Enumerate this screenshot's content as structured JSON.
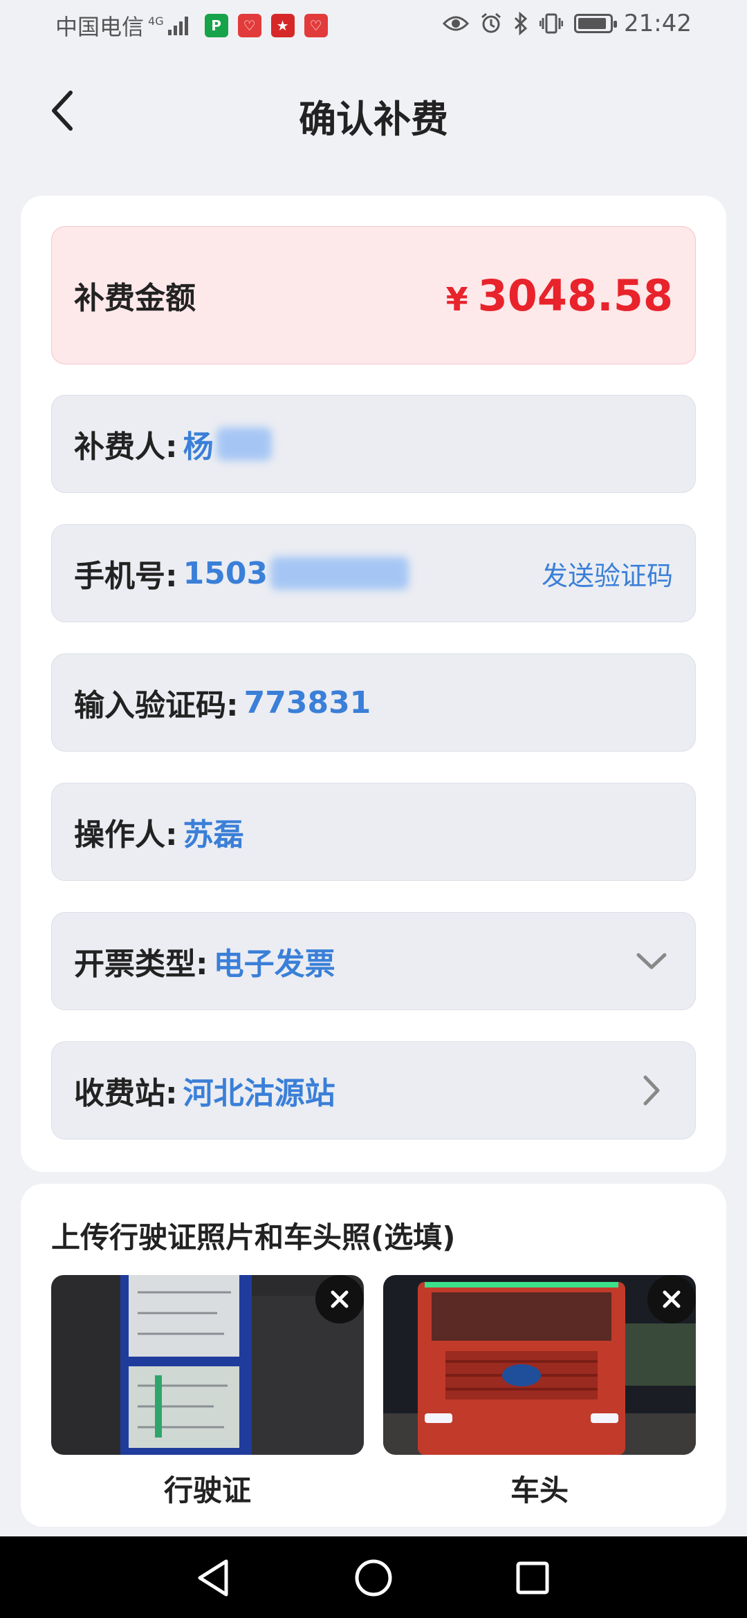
{
  "status_bar": {
    "carrier": "中国电信",
    "network": "4G",
    "time": "21:42",
    "app_badges": [
      "P",
      "♡",
      "★",
      "♡"
    ],
    "icons": [
      "eye-icon",
      "alarm-icon",
      "bluetooth-icon",
      "vibrate-icon",
      "battery-icon"
    ]
  },
  "header": {
    "title": "确认补费",
    "back_icon": "chevron-left-icon"
  },
  "form": {
    "amount": {
      "label": "补费金额",
      "currency": "¥",
      "value": "3048.58",
      "color": "#e8232b"
    },
    "payer": {
      "label": "补费人:",
      "value": "杨"
    },
    "phone": {
      "label": "手机号:",
      "value": "1503",
      "action": "发送验证码"
    },
    "code": {
      "label": "输入验证码:",
      "value": "773831"
    },
    "operator": {
      "label": "操作人:",
      "value": "苏磊"
    },
    "invoice_type": {
      "label": "开票类型:",
      "value": "电子发票",
      "icon": "chevron-down-icon"
    },
    "station": {
      "label": "收费站:",
      "value": "河北沽源站",
      "icon": "chevron-right-icon"
    }
  },
  "upload": {
    "title": "上传行驶证照片和车头照(选填)",
    "photos": [
      {
        "label": "行驶证",
        "image": "vehicle-license-photo"
      },
      {
        "label": "车头",
        "image": "truck-front-photo"
      }
    ]
  },
  "colors": {
    "accent": "#3a7fd8",
    "amount": "#e8232b",
    "background": "#f0f1f5"
  }
}
